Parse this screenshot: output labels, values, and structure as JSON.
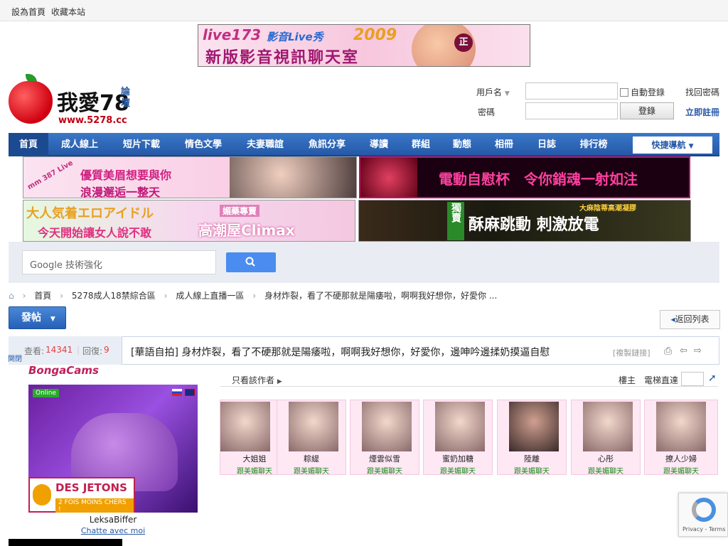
{
  "topbar": {
    "set_home": "設為首頁",
    "bookmark": "收藏本站"
  },
  "banner": {
    "brand": "live173",
    "media": "影音Live秀",
    "year": "2009",
    "headline": "新版影音視訊聊天室",
    "badge": "正"
  },
  "logo": {
    "name": "我愛78",
    "sub": "論壇",
    "url": "www.5278.cc"
  },
  "login": {
    "username_label": "用戶名",
    "username_value": "",
    "password_label": "密碼",
    "password_value": "",
    "auto_login": "自動登錄",
    "forgot": "找回密碼",
    "login_btn": "登錄",
    "register": "立即註冊"
  },
  "nav": {
    "items": [
      "首頁",
      "成人線上",
      "短片下載",
      "情色文學",
      "夫妻職誼",
      "魚訊分享",
      "導讀",
      "群組",
      "動態",
      "相冊",
      "日誌",
      "排行榜"
    ],
    "quick": "快捷導航"
  },
  "ads": {
    "ad1": {
      "line1": "優質美眉想要與你",
      "line2": "浪漫邂逅一整天",
      "tag": "mm 387 Live"
    },
    "ad2": {
      "text": "電動自慰杯　令你銷魂一射如注"
    },
    "ad3": {
      "line1": "大人気着エロアイドル",
      "line2": "今天開始讓女人說不敢",
      "line3": "媚藥專賣",
      "line4": "高潮屋Climax"
    },
    "ad4": {
      "tag": "獨賣",
      "text": "酥麻跳動 刺激放電",
      "sub": "大麻陰蒂高潮凝膠"
    }
  },
  "search": {
    "placeholder": "Google 技術強化"
  },
  "breadcrumb": [
    "首頁",
    "5278成人18禁綜合區",
    "成人線上直播一區",
    "身材炸裂，看了不硬那就是陽痿啦，啊啊我好想你，好愛你 ..."
  ],
  "toolbar": {
    "post": "發帖",
    "back": "返回列表"
  },
  "thread": {
    "views_label": "查看:",
    "views": "14341",
    "replies_label": "回復:",
    "replies": "9",
    "title": "[華語自拍] 身材炸裂，看了不硬那就是陽痿啦，啊啊我好想你，好愛你，邊呻吟邊揉奶摸逼自慰",
    "copy_link": "[複製鏈接]"
  },
  "sidebar_ad": {
    "close": "関閉",
    "brand": "BongaCams",
    "online": "Online",
    "promo1": "DES JETONS",
    "promo2": "2 FOIS MOINS CHERS !",
    "name": "LeksaBiffer",
    "link": "Chatte avec moi"
  },
  "post": {
    "only_author": "只看該作者",
    "floor_owner": "樓主",
    "elevator": "電梯直達"
  },
  "models": [
    {
      "name": "大姐姐",
      "cta": "跟美媚聊天"
    },
    {
      "name": "粽緹",
      "cta": "跟美媚聊天"
    },
    {
      "name": "煙雲似雪",
      "cta": "跟美媚聊天"
    },
    {
      "name": "蜜奶加糖",
      "cta": "跟美媚聊天"
    },
    {
      "name": "陸離",
      "cta": "跟美媚聊天"
    },
    {
      "name": "心彤",
      "cta": "跟美媚聊天"
    },
    {
      "name": "撩人少婦",
      "cta": "跟美媚聊天"
    }
  ],
  "recaptcha": {
    "privacy": "Privacy",
    "sep": " - ",
    "terms": "Terms"
  },
  "colors": {
    "nav": "#2559a8",
    "accent": "#c02050",
    "green": "#1a8a1a"
  }
}
